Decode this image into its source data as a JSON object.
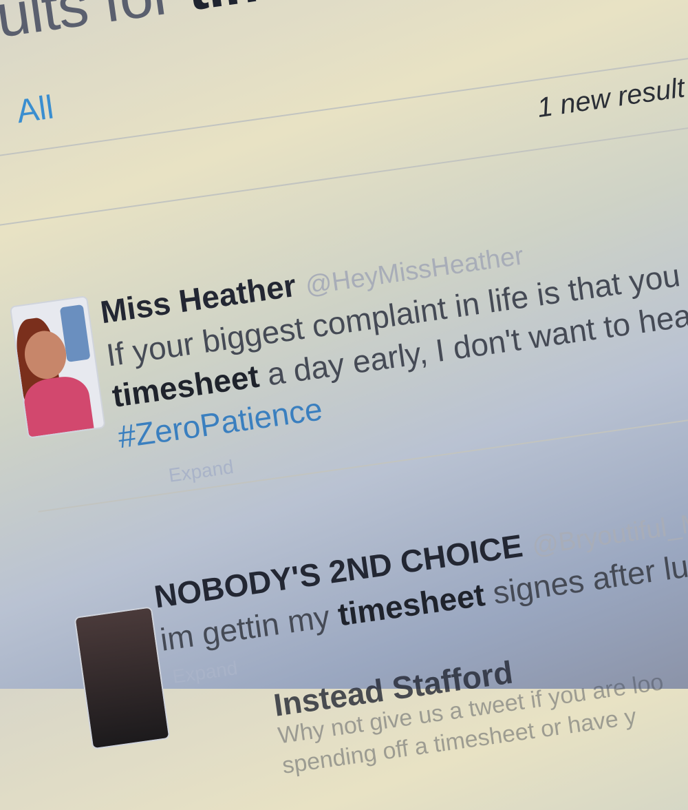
{
  "header": {
    "title_prefix": "ults for ",
    "title_query": "timesheet",
    "tab_all": "All"
  },
  "results_bar": {
    "new_results": "1 new result"
  },
  "tweets": [
    {
      "name": "Miss Heather",
      "handle": "@HeyMissHeather",
      "line1": "If your biggest complaint in life is that you",
      "line2_bold": "timesheet",
      "line2_rest": " a day early, I don't want to hea",
      "hashtag": "#ZeroPatience",
      "expand": "Expand"
    },
    {
      "name": "NOBODY'S 2ND CHOICE",
      "handle": "@Bryoutiful_ME",
      "line1_pre": "im gettin my ",
      "line1_bold": "timesheet",
      "line1_rest": " signes after luch and the",
      "expand": "Expand"
    },
    {
      "name": "Instead Stafford",
      "line1": "Why not give us a tweet if you are loo",
      "line2": "spending off a timesheet or have y"
    }
  ],
  "colors": {
    "link": "#3a8ed0",
    "hashtag": "#3a7fbf",
    "name": "#232733",
    "handle": "#a8adb8"
  }
}
